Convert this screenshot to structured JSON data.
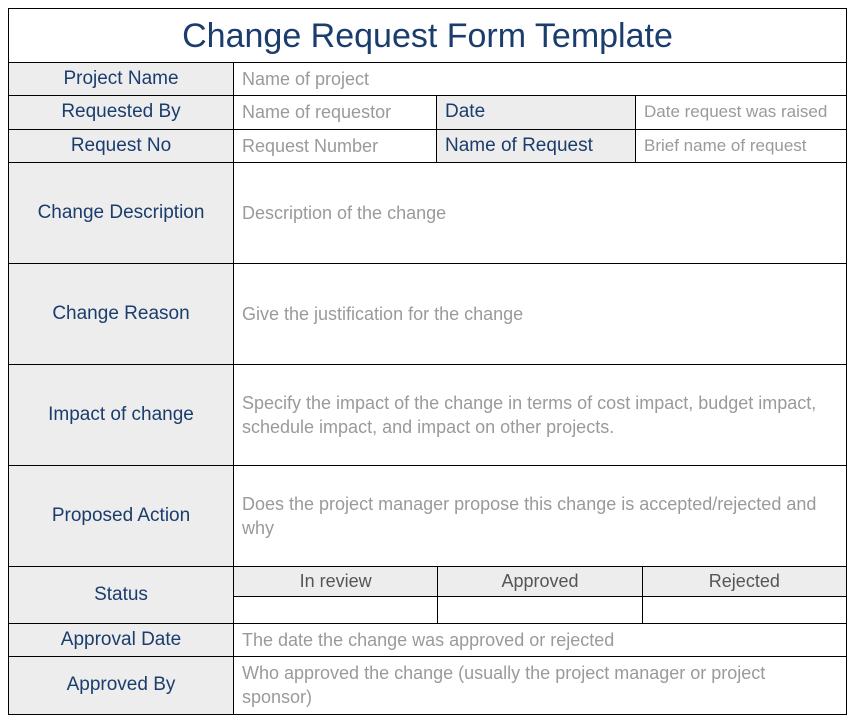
{
  "title": "Change Request Form Template",
  "rows": {
    "project_name": {
      "label": "Project Name",
      "placeholder": "Name of project"
    },
    "requested_by": {
      "label": "Requested By",
      "placeholder": "Name of requestor"
    },
    "date": {
      "label": "Date",
      "placeholder": "Date request was raised"
    },
    "request_no": {
      "label": "Request No",
      "placeholder": "Request Number"
    },
    "name_of_request": {
      "label": "Name of Request",
      "placeholder": "Brief name of request"
    },
    "change_description": {
      "label": "Change Description",
      "placeholder": "Description of the change"
    },
    "change_reason": {
      "label": "Change Reason",
      "placeholder": "Give the justification for the change"
    },
    "impact_of_change": {
      "label": "Impact of change",
      "placeholder": "Specify the impact of the change in terms of cost impact, budget impact, schedule impact, and impact on other projects."
    },
    "proposed_action": {
      "label": "Proposed Action",
      "placeholder": "Does the project manager propose this change is accepted/rejected and why"
    },
    "status": {
      "label": "Status"
    },
    "approval_date": {
      "label": "Approval Date",
      "placeholder": "The date the change was approved or rejected"
    },
    "approved_by": {
      "label": "Approved By",
      "placeholder": "Who approved the change (usually the project manager or project sponsor)"
    }
  },
  "status_options": {
    "in_review": "In review",
    "approved": "Approved",
    "rejected": "Rejected"
  }
}
